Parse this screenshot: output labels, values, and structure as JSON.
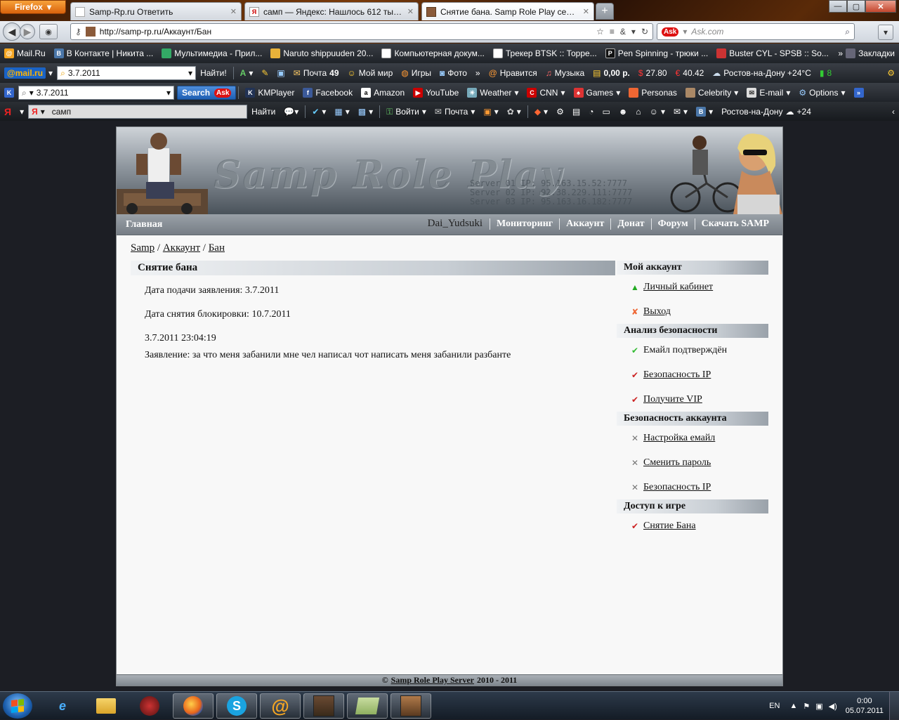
{
  "browser": {
    "app_button": "Firefox",
    "tabs": [
      {
        "title": "Samp-Rp.ru Ответить",
        "active": false
      },
      {
        "title": "самп — Яндекс: Нашлось 612 тыс. о...",
        "active": false
      },
      {
        "title": "Снятие бана. Samp Role Play сервер...",
        "active": true
      }
    ],
    "url": "http://samp-rp.ru/Аккаунт/Бан",
    "search_placeholder": "Ask.com",
    "bookmarks": [
      "Mail.Ru",
      "В Контакте | Никита ...",
      "Мультимедиа - Прил...",
      "Naruto shippuuden 20...",
      "Компьютерная докум...",
      "Трекер BTSK :: Торре...",
      "Pen Spinning - трюки ...",
      "Buster CYL - SPSB :: So..."
    ],
    "bookmarks_menu": "Закладки",
    "mailru_toolbar": {
      "logo": "@mail.ru",
      "search_value": "3.7.2011",
      "find_button": "Найти!",
      "mail_label": "Почта",
      "mail_count": "49",
      "my_world": "Мой мир",
      "games": "Игры",
      "photo": "Фото",
      "likes": "Нравится",
      "music": "Музыка",
      "balance": "0,00 р.",
      "usd": "27.80",
      "eur": "40.42",
      "weather": "Ростов-на-Дону +24°C",
      "count8": "8"
    },
    "ask_toolbar": {
      "search_value": "3.7.2011",
      "search_button": "Search",
      "links": [
        "KMPlayer",
        "Facebook",
        "Amazon",
        "YouTube",
        "Weather",
        "CNN",
        "Games",
        "Personas",
        "Celebrity",
        "E-mail",
        "Options"
      ]
    },
    "yandex_toolbar": {
      "search_value": "самп",
      "find_button": "Найти",
      "login": "Войти",
      "mail": "Почта",
      "weather": "Ростов-на-Дону",
      "temp": "+24"
    }
  },
  "site": {
    "logo_text": "Samp Role Play",
    "servers": [
      "Server 01 IP: 95.163.15.52:7777",
      "Server 02 IP: 92.38.229.111:7777",
      "Server 03 IP: 95.163.16.182:7777"
    ],
    "nav": {
      "home": "Главная",
      "username": "Dai_Yudsuki",
      "items": [
        "Мониторинг",
        "Аккаунт",
        "Донат",
        "Форум",
        "Скачать SAMP"
      ]
    },
    "breadcrumbs": [
      "Samp",
      "Аккаунт",
      "Бан"
    ],
    "main": {
      "title": "Снятие бана",
      "submitted": "Дата подачи заявления: 3.7.2011",
      "unblock": "Дата снятия блокировки: 10.7.2011",
      "timestamp": "3.7.2011 23:04:19",
      "statement": "Заявление: за что меня забанили мне чел написал чот написать меня забанили разбанте"
    },
    "sidebar": [
      {
        "title": "Мой аккаунт",
        "items": [
          {
            "label": "Личный кабинет",
            "icon": "green-arrow-up-icon",
            "link": true
          },
          {
            "label": "Выход",
            "icon": "orange-x-icon",
            "link": true
          }
        ]
      },
      {
        "title": "Анализ безопасности",
        "items": [
          {
            "label": "Емайл подтверждён",
            "icon": "green-check-icon",
            "link": false
          },
          {
            "label": "Безопасность IP",
            "icon": "red-check-icon",
            "link": true
          },
          {
            "label": "Получите VIP",
            "icon": "red-check-icon",
            "link": true
          }
        ]
      },
      {
        "title": "Безопасность аккаунта",
        "items": [
          {
            "label": "Настройка емайл",
            "icon": "tools-icon",
            "link": true
          },
          {
            "label": "Сменить пароль",
            "icon": "tools-icon",
            "link": true
          },
          {
            "label": "Безопасность IP",
            "icon": "tools-icon",
            "link": true
          }
        ]
      },
      {
        "title": "Доступ к игре",
        "items": [
          {
            "label": "Снятие Бана",
            "icon": "red-check-icon",
            "link": true
          }
        ]
      }
    ],
    "footer": {
      "prefix": "©",
      "link": "Samp Role Play Server",
      "years": "2010 - 2011"
    }
  },
  "taskbar": {
    "lang": "EN",
    "time": "0:00",
    "date": "05.07.2011"
  }
}
